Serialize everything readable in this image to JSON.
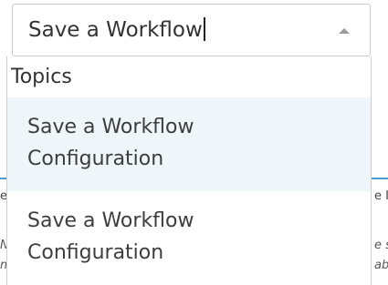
{
  "combo": {
    "value": "Save a Workflow"
  },
  "dropdown": {
    "group_label": "Topics",
    "options": [
      {
        "line1": "Save a Workflow",
        "line2": "Configuration",
        "highlighted": true
      },
      {
        "line1": "Save a Workflow",
        "line2": "Configuration",
        "highlighted": false
      }
    ]
  },
  "background": {
    "frag_left_1": "e",
    "frag_right_1": "e I",
    "frag_left_2": "N",
    "frag_right_2": "e s",
    "frag_left_3": "m",
    "frag_right_3": "ab"
  },
  "colors": {
    "highlight": "#eef6fa",
    "accent_line": "#4c9bd6"
  }
}
